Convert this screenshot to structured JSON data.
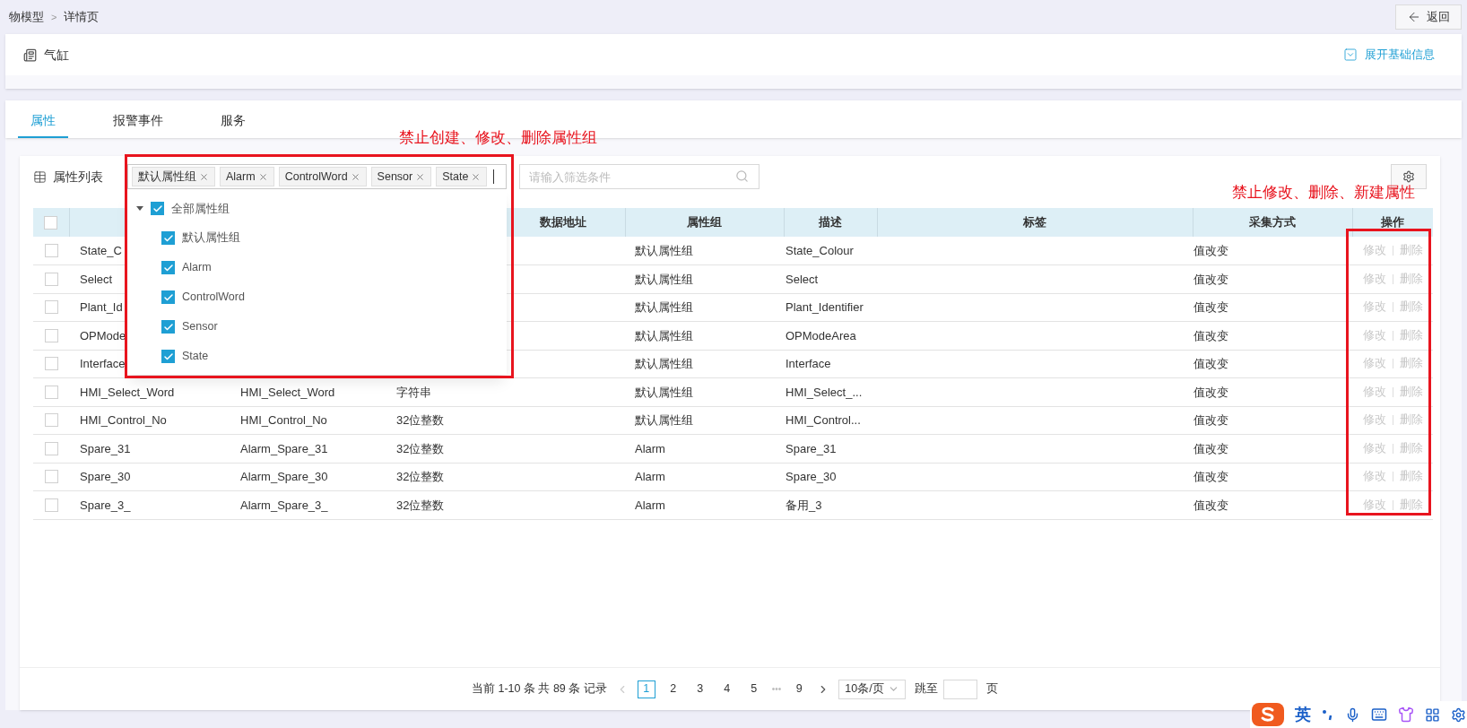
{
  "breadcrumb": {
    "items": [
      "物模型",
      "详情页"
    ],
    "separator": ">"
  },
  "back_button": "返回",
  "header": {
    "title": "气缸",
    "expand_link": "展开基础信息"
  },
  "tabs": [
    {
      "label": "属性",
      "selected": true
    },
    {
      "label": "报警事件",
      "selected": false
    },
    {
      "label": "服务",
      "selected": false
    }
  ],
  "panel_title": "属性列表",
  "group_select": {
    "tags": [
      "默认属性组",
      "Alarm",
      "ControlWord",
      "Sensor",
      "State"
    ],
    "tree": {
      "label": "全部属性组",
      "checked": true,
      "expanded": true,
      "children": [
        {
          "label": "默认属性组",
          "checked": true
        },
        {
          "label": "Alarm",
          "checked": true
        },
        {
          "label": "ControlWord",
          "checked": true
        },
        {
          "label": "Sensor",
          "checked": true
        },
        {
          "label": "State",
          "checked": true
        }
      ]
    }
  },
  "search": {
    "placeholder": "请输入筛选条件"
  },
  "table": {
    "select_all_checked": false,
    "columns": [
      "数据地址",
      "属性组",
      "描述",
      "标签",
      "采集方式",
      "操作"
    ],
    "rows": [
      {
        "checked": false,
        "column_2": "State_C",
        "group": "默认属性组",
        "description": "State_Colour",
        "collection": "值改变",
        "actions": [
          {
            "label": "修改",
            "disabled": true
          },
          {
            "label": "删除",
            "disabled": true
          }
        ]
      },
      {
        "checked": false,
        "column_2": "Select",
        "group": "默认属性组",
        "description": "Select",
        "collection": "值改变",
        "actions": [
          {
            "label": "修改",
            "disabled": true
          },
          {
            "label": "删除",
            "disabled": true
          }
        ]
      },
      {
        "checked": false,
        "column_2": "Plant_Id",
        "group": "默认属性组",
        "description": "Plant_Identifier",
        "collection": "值改变",
        "actions": [
          {
            "label": "修改",
            "disabled": true
          },
          {
            "label": "删除",
            "disabled": true
          }
        ]
      },
      {
        "checked": false,
        "column_2": "OPMode",
        "group": "默认属性组",
        "description": "OPModeArea",
        "collection": "值改变",
        "actions": [
          {
            "label": "修改",
            "disabled": true
          },
          {
            "label": "删除",
            "disabled": true
          }
        ]
      },
      {
        "checked": false,
        "column_2": "Interface",
        "group": "默认属性组",
        "description": "Interface",
        "collection": "值改变",
        "actions": [
          {
            "label": "修改",
            "disabled": true
          },
          {
            "label": "删除",
            "disabled": true
          }
        ]
      },
      {
        "checked": false,
        "column_2": "HMI_Select_Word",
        "column_3": "HMI_Select_Word",
        "column_4": "字符串",
        "group": "默认属性组",
        "description": "HMI_Select_...",
        "collection": "值改变",
        "actions": [
          {
            "label": "修改",
            "disabled": true
          },
          {
            "label": "删除",
            "disabled": true
          }
        ]
      },
      {
        "checked": false,
        "column_2": "HMI_Control_No",
        "column_3": "HMI_Control_No",
        "column_4": "32位整数",
        "group": "默认属性组",
        "description": "HMI_Control...",
        "collection": "值改变",
        "actions": [
          {
            "label": "修改",
            "disabled": true
          },
          {
            "label": "删除",
            "disabled": true
          }
        ]
      },
      {
        "checked": false,
        "column_2": "Spare_31",
        "column_3": "Alarm_Spare_31",
        "column_4": "32位整数",
        "group": "Alarm",
        "description": "Spare_31",
        "collection": "值改变",
        "actions": [
          {
            "label": "修改",
            "disabled": true
          },
          {
            "label": "删除",
            "disabled": true
          }
        ]
      },
      {
        "checked": false,
        "column_2": "Spare_30",
        "column_3": "Alarm_Spare_30",
        "column_4": "32位整数",
        "group": "Alarm",
        "description": "Spare_30",
        "collection": "值改变",
        "actions": [
          {
            "label": "修改",
            "disabled": true
          },
          {
            "label": "删除",
            "disabled": true
          }
        ]
      },
      {
        "checked": false,
        "column_2": "Spare_3_",
        "column_3": "Alarm_Spare_3_",
        "column_4": "32位整数",
        "group": "Alarm",
        "description": "备用_3",
        "collection": "值改变",
        "actions": [
          {
            "label": "修改",
            "disabled": true
          },
          {
            "label": "删除",
            "disabled": true
          }
        ]
      }
    ]
  },
  "pagination": {
    "summary": "当前 1-10 条 共 89 条 记录",
    "pages": [
      {
        "label": "1",
        "kind": "page",
        "selected": true
      },
      {
        "label": "2",
        "kind": "page",
        "selected": false
      },
      {
        "label": "3",
        "kind": "page",
        "selected": false
      },
      {
        "label": "4",
        "kind": "page",
        "selected": false
      },
      {
        "label": "5",
        "kind": "page",
        "selected": false
      },
      {
        "label": "•••",
        "kind": "ellipsis",
        "selected": false
      },
      {
        "label": "9",
        "kind": "page",
        "selected": false
      }
    ],
    "page_size": "10条/页",
    "jump_label": "跳至",
    "jump_suffix": "页"
  },
  "annotations": {
    "group_select": "禁止创建、修改、删除属性组",
    "actions": "禁止修改、删除、新建属性"
  },
  "ime_toolbar": {
    "language": "英"
  }
}
